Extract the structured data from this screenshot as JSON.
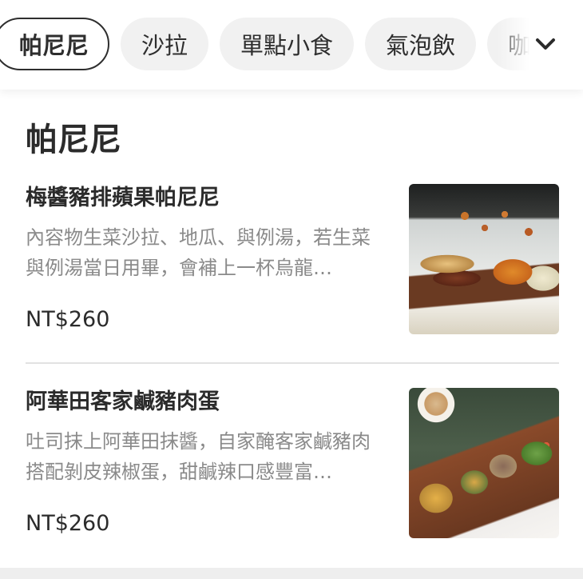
{
  "tabs": [
    {
      "label": "帕尼尼",
      "active": true
    },
    {
      "label": "沙拉",
      "active": false
    },
    {
      "label": "單點小食",
      "active": false
    },
    {
      "label": "氣泡飲",
      "active": false
    },
    {
      "label": "咖",
      "active": false
    }
  ],
  "more_icon": "chevron-down-icon",
  "section": {
    "title": "帕尼尼"
  },
  "items": [
    {
      "name": "梅醬豬排蘋果帕尼尼",
      "description": "內容物生菜沙拉、地瓜、與例湯，若生菜與例湯當日用畢，會補上一杯烏龍…",
      "price": "NT$260"
    },
    {
      "name": "阿華田客家鹹豬肉蛋",
      "description": "吐司抹上阿華田抹醬，自家醃客家鹹豬肉搭配剝皮辣椒蛋，甜鹹辣口感豐富…",
      "price": "NT$260"
    }
  ],
  "colors": {
    "text": "#2b2b2b",
    "muted": "#8a8a8a",
    "tab_bg": "#f1f1f1",
    "divider": "#e2e2e2"
  }
}
